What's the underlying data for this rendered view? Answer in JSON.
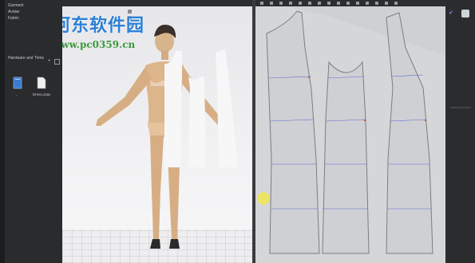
{
  "library": {
    "items": [
      "Garment",
      "Avatar",
      "Fabric",
      "Hardware and Trims"
    ],
    "files": [
      {
        "name": "..",
        "icon": "folder-icon"
      },
      {
        "name": "Dress.zpac",
        "icon": "file-icon"
      }
    ]
  },
  "watermark": {
    "title": "河东软件园",
    "url": "www.pc0359.cn"
  },
  "colors": {
    "accent": "#2b7fd6",
    "pattern_fill": "#cfd0d3",
    "pattern_line": "#7a7d83",
    "baseline": "#5c6bd6",
    "notch": "#d24a4a"
  }
}
